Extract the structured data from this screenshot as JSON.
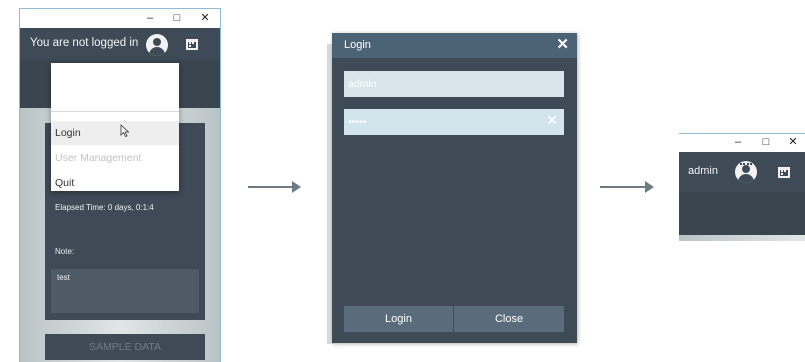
{
  "panel1": {
    "window_controls": {
      "minimize": "–",
      "maximize": "□",
      "close": "✕"
    },
    "header_title": "You are not logged in",
    "menu": {
      "items": [
        {
          "label": "Login",
          "state": "hover"
        },
        {
          "label": "User Management",
          "state": "disabled"
        },
        {
          "label": "Quit",
          "state": "normal"
        }
      ]
    },
    "card": {
      "elapsed": "Elapsed Time: 0 days, 0:1:4",
      "note_label": "Note:",
      "note_value": "test"
    },
    "sample_button": "SAMPLE DATA"
  },
  "login_dialog": {
    "title": "Login",
    "close_glyph": "✕",
    "username_value": "admin",
    "password_value": "•••••",
    "clear_glyph": "✕",
    "login_button": "Login",
    "close_button": "Close"
  },
  "panel3": {
    "window_controls": {
      "minimize": "–",
      "maximize": "□",
      "close": "✕"
    },
    "header_title": "admin"
  },
  "colors": {
    "header_bg": "#3e4a55",
    "dialog_title_bg": "#4c6275",
    "field_bg": "#d8e6ec",
    "button_bg": "#5a6c7c"
  }
}
